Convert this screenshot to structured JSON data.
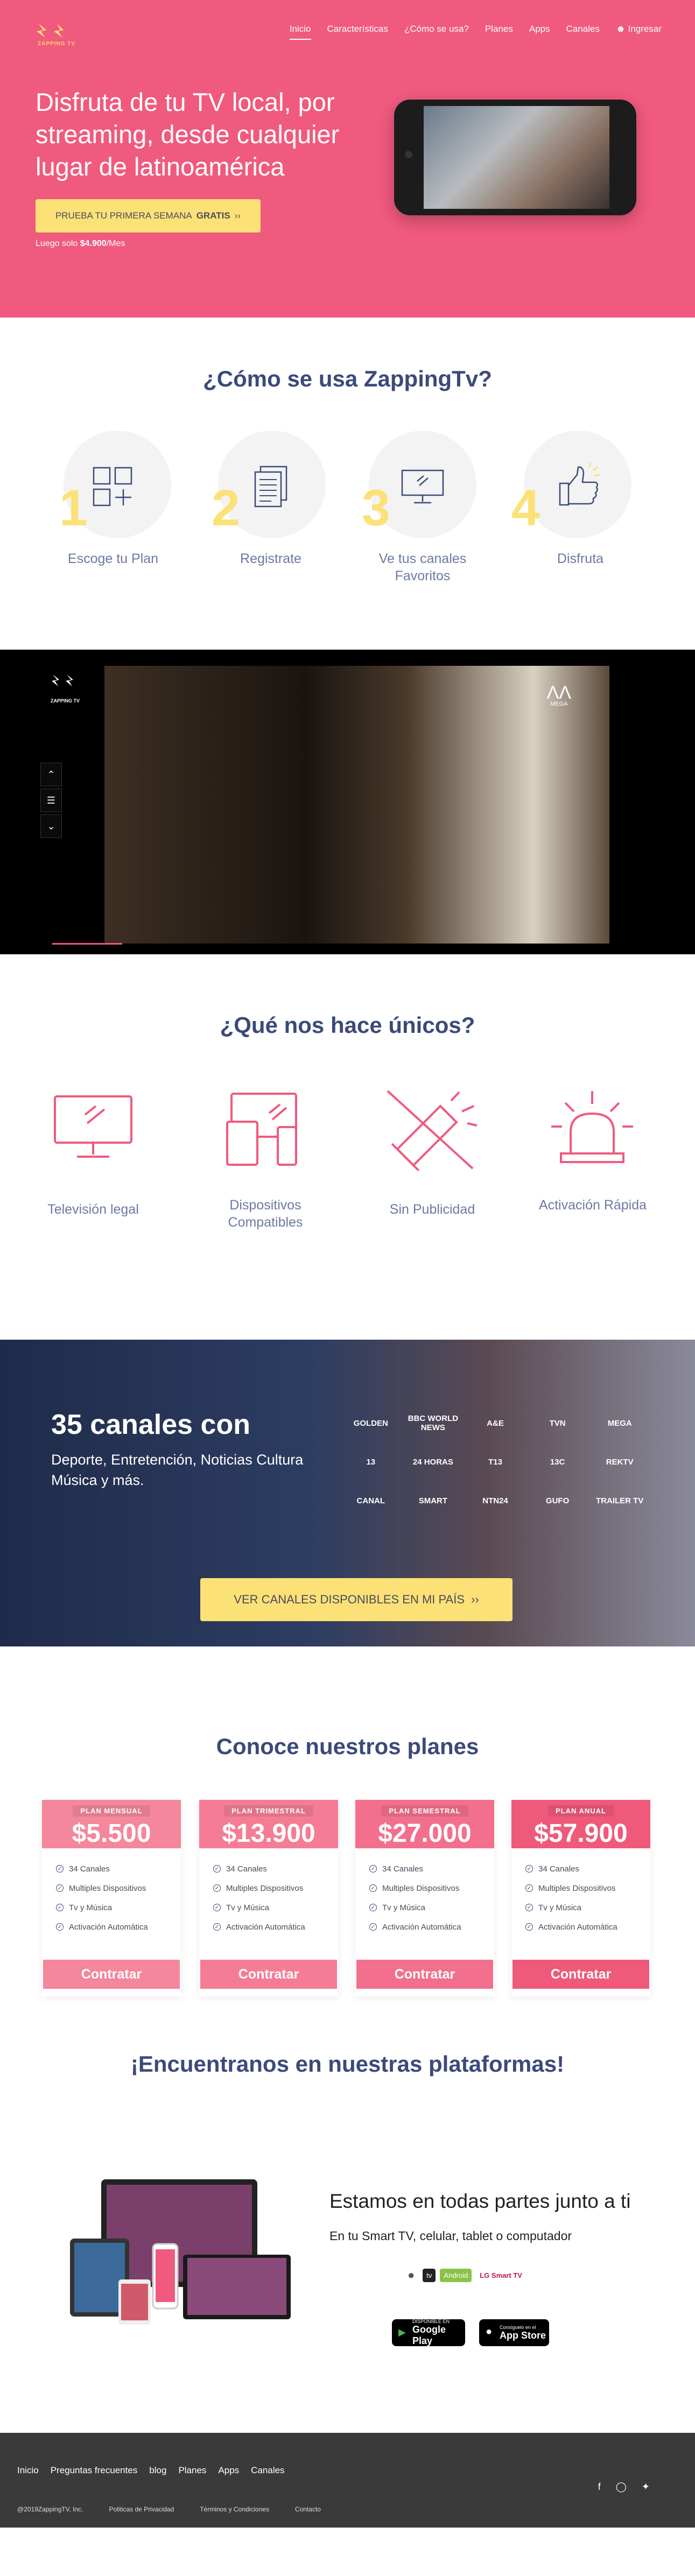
{
  "brand": {
    "name": "ZAPPING TV"
  },
  "nav": {
    "items": [
      "Inicio",
      "Características",
      "¿Cómo se usa?",
      "Planes",
      "Apps",
      "Canales"
    ],
    "login": "Ingresar"
  },
  "hero": {
    "headline": "Disfruta de tu TV local, por streaming, desde cualquier lugar de latinoamérica",
    "cta_prefix": "PRUEBA TU PRIMERA SEMANA",
    "cta_bold": "GRATIS",
    "price_prefix": "Luego solo",
    "price_value": "$4.900",
    "price_suffix": "/Mes"
  },
  "how": {
    "title": "¿Cómo se usa ZappingTv?",
    "steps": [
      {
        "num": "1",
        "label": "Escoge tu Plan"
      },
      {
        "num": "2",
        "label": "Registrate"
      },
      {
        "num": "3",
        "label": "Ve tus canales Favoritos"
      },
      {
        "num": "4",
        "label": "Disfruta"
      }
    ]
  },
  "video": {
    "brand": "ZAPPING TV",
    "channel": "MEGA"
  },
  "unique": {
    "title": "¿Qué nos hace únicos?",
    "items": [
      "Televisión legal",
      "Dispositivos Compatibles",
      "Sin Publicidad",
      "Activación Rápida"
    ]
  },
  "channels": {
    "title": "35 canales con",
    "description": "Deporte, Entretención, Noticias Cultura Música y más.",
    "logos": [
      "GOLDEN",
      "BBC WORLD NEWS",
      "A&E",
      "TVN",
      "MEGA",
      "13",
      "24 HORAS",
      "T13",
      "13C",
      "REKTV",
      "CANAL",
      "SMART",
      "NTN24",
      "GUFO",
      "TRAILER TV"
    ],
    "button": "VER CANALES DISPONIBLES EN MI PAÍS"
  },
  "plans": {
    "title": "Conoce nuestros planes",
    "features": [
      "34 Canales",
      "Multiples Dispositivos",
      "Tv y Música",
      "Activación Automática"
    ],
    "button": "Contratar",
    "items": [
      {
        "name": "PLAN MENSUAL",
        "price": "$5.500",
        "color": "#f4879b"
      },
      {
        "name": "PLAN TRIMESTRAL",
        "price": "$13.900",
        "color": "#f47d95"
      },
      {
        "name": "PLAN SEMESTRAL",
        "price": "$27.000",
        "color": "#f2708d"
      },
      {
        "name": "PLAN ANUAL",
        "price": "$57.900",
        "color": "#ef5a7a"
      }
    ]
  },
  "platforms": {
    "title": "¡Encuentranos en nuestras plataformas!",
    "heading": "Estamos en todas partes junto a ti",
    "subheading": "En tu Smart TV, celular, tablet o computador",
    "logos": [
      "",
      "tv",
      "Android",
      "LG Smart TV"
    ],
    "google_small": "DISPONIBLE EN",
    "google": "Google Play",
    "apple_small": "Consíguelo en el",
    "apple": "App Store"
  },
  "footer": {
    "links": [
      "Inicio",
      "Preguntas frecuentes",
      "blog",
      "Planes",
      "Apps",
      "Canales"
    ],
    "small": [
      "@2019ZappingTV, Inc.",
      "Politicas de Privacidad",
      "Términos y Condiciones",
      "Contacto"
    ]
  },
  "colors": {
    "primary": "#f05a7e",
    "accent": "#fce177",
    "title": "#3b4a7a",
    "footer": "#3a3a3a"
  }
}
